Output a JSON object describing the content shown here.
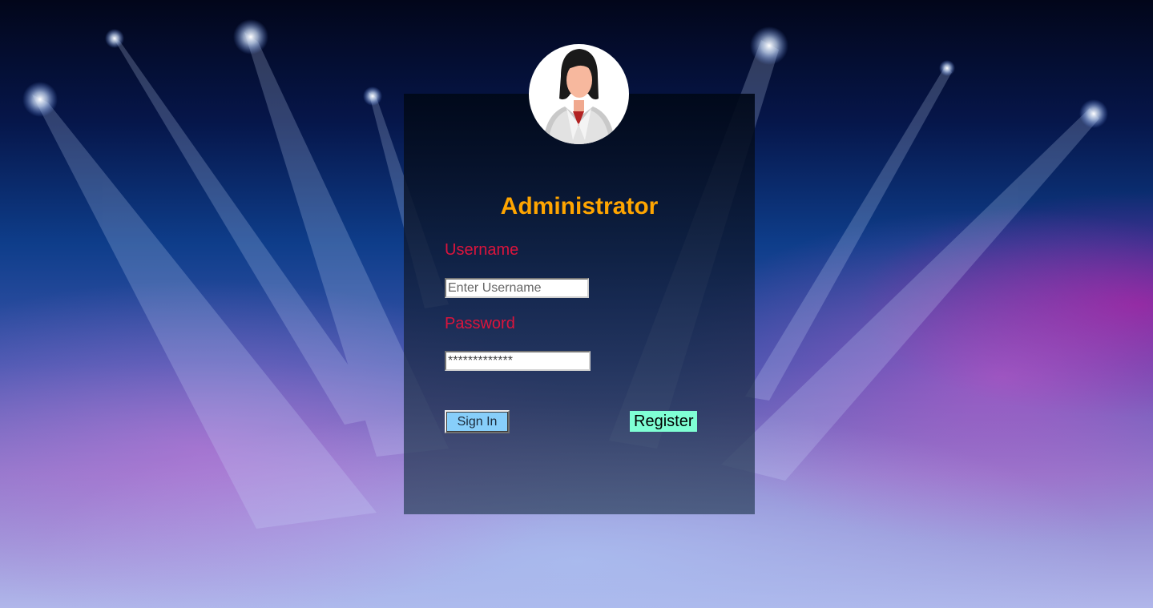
{
  "login": {
    "title": "Administrator",
    "username_label": "Username",
    "username_placeholder": "Enter Username",
    "password_label": "Password",
    "password_value": "*************",
    "signin_label": "Sign In",
    "register_label": "Register"
  },
  "colors": {
    "title": "#ffa500",
    "labels": "#dc143c",
    "signin_button": "#87cefa",
    "register_button": "#7fffd4"
  },
  "icons": {
    "avatar": "businesswoman-avatar-icon"
  }
}
